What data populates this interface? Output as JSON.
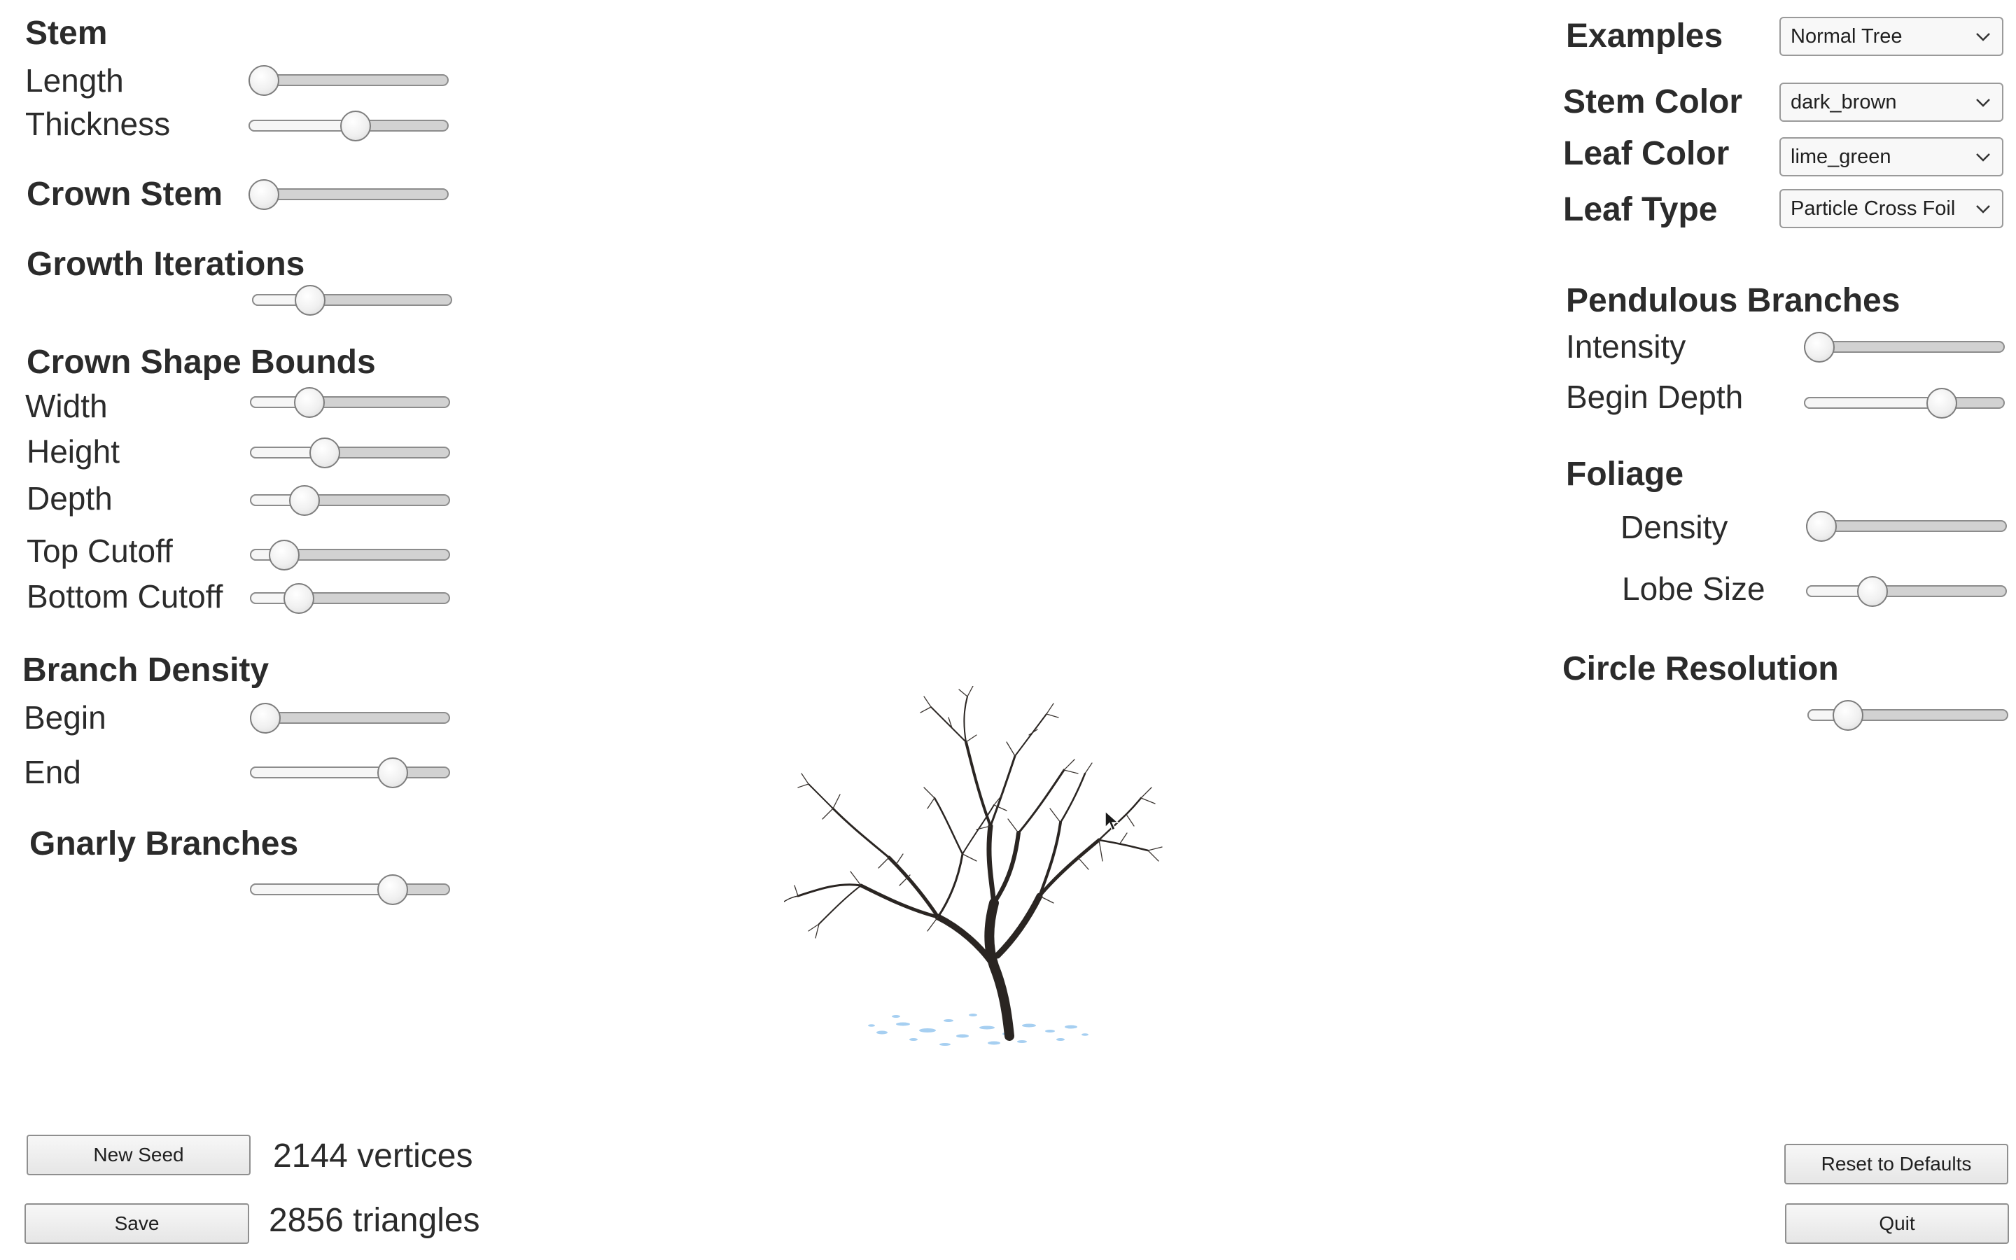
{
  "left_panel": {
    "stem": {
      "heading": "Stem",
      "length_label": "Length",
      "length_value": 0.0,
      "thickness_label": "Thickness",
      "thickness_value": 0.54
    },
    "crown_stem": {
      "heading": "Crown Stem",
      "value": 0.0
    },
    "growth_iterations": {
      "heading": "Growth Iterations",
      "value": 0.25
    },
    "crown_shape_bounds": {
      "heading": "Crown Shape Bounds",
      "width_label": "Width",
      "width_value": 0.26,
      "height_label": "Height",
      "height_value": 0.35,
      "depth_label": "Depth",
      "depth_value": 0.23,
      "top_cutoff_label": "Top Cutoff",
      "top_cutoff_value": 0.11,
      "bottom_cutoff_label": "Bottom Cutoff",
      "bottom_cutoff_value": 0.2
    },
    "branch_density": {
      "heading": "Branch Density",
      "begin_label": "Begin",
      "begin_value": 0.0,
      "end_label": "End",
      "end_value": 0.75
    },
    "gnarly_branches": {
      "heading": "Gnarly Branches",
      "value": 0.75
    }
  },
  "right_panel": {
    "examples": {
      "label": "Examples",
      "selected": "Normal Tree"
    },
    "stem_color": {
      "label": "Stem Color",
      "selected": "dark_brown"
    },
    "leaf_color": {
      "label": "Leaf Color",
      "selected": "lime_green"
    },
    "leaf_type": {
      "label": "Leaf Type",
      "selected": "Particle Cross Foil"
    },
    "pendulous_branches": {
      "heading": "Pendulous Branches",
      "intensity_label": "Intensity",
      "intensity_value": 0.0,
      "begin_depth_label": "Begin Depth",
      "begin_depth_value": 0.72
    },
    "foliage": {
      "heading": "Foliage",
      "density_label": "Density",
      "density_value": 0.0,
      "lobe_size_label": "Lobe Size",
      "lobe_size_value": 0.3
    },
    "circle_resolution": {
      "heading": "Circle Resolution",
      "value": 0.15
    }
  },
  "bottom": {
    "new_seed_label": "New Seed",
    "save_label": "Save",
    "vertices_text": "2144 vertices",
    "triangles_text": "2856 triangles",
    "reset_label": "Reset to Defaults",
    "quit_label": "Quit"
  },
  "icons": {
    "dropdown": "chevron-down-icon",
    "cursor": "mouse-pointer-icon",
    "viewport": "tree-model"
  },
  "colors": {
    "stem": "#2a2522",
    "leaf_particles": "#5fa8e6"
  }
}
